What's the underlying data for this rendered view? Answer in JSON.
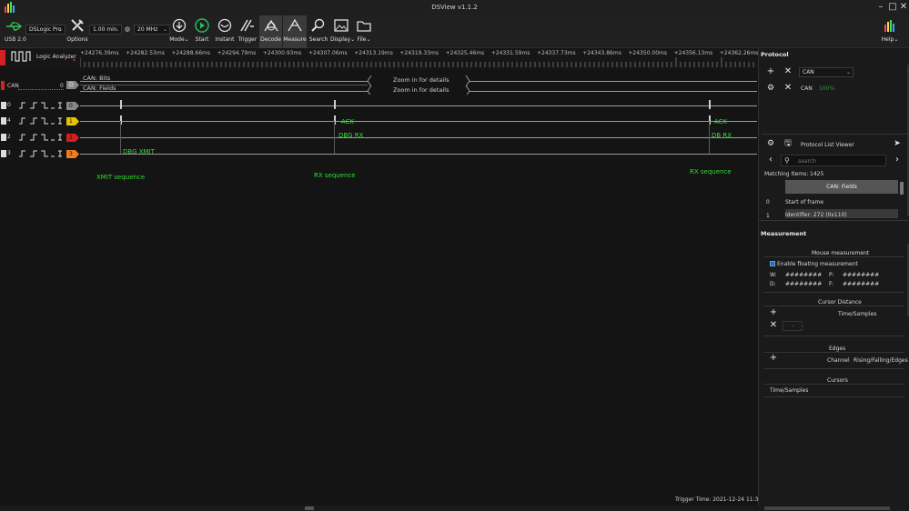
{
  "window": {
    "title": "DSView v1.1.2"
  },
  "toolbar": {
    "device_name": "DSLogic Pro",
    "usb_label": "USB 2.0",
    "options_label": "Options",
    "duration": "1.00 min",
    "samplerate": "20 MHz",
    "buttons": {
      "mode": "Mode",
      "start": "Start",
      "instant": "Instant",
      "trigger": "Trigger",
      "decode": "Decode",
      "measure": "Measure",
      "search": "Search",
      "display": "Display",
      "file": "File",
      "help": "Help"
    }
  },
  "ruler": {
    "mode_label": "Logic Analyzer",
    "ticks": [
      "+24276.39ms",
      "+24282.53ms",
      "+24288.66ms",
      "+24294.79ms",
      "+24300.93ms",
      "+24307.06ms",
      "+24313.19ms",
      "+24319.33ms",
      "+24325.46ms",
      "+24331.59ms",
      "+24337.73ms",
      "+24343.86ms",
      "+24350.00ms",
      "+24356.13ms",
      "+24362.26ms"
    ]
  },
  "channels": {
    "can": {
      "name": "CAN",
      "index": "0",
      "badge": "D",
      "rows": [
        "CAN: Bits",
        "CAN: Fields"
      ],
      "zoom_msg": "Zoom in for details"
    },
    "ch0": {
      "index": "0",
      "badge": "0"
    },
    "ch4": {
      "index": "4",
      "badge": "1",
      "ann1": "ACK",
      "ann2": "ACK"
    },
    "ch2": {
      "index": "2",
      "badge": "2",
      "ann1": "DBG RX",
      "ann2": "DB RX"
    },
    "ch3": {
      "index": "3",
      "badge": "3",
      "ann1": "DBG XMIT"
    },
    "notes": {
      "xmit": "XMIT sequence",
      "rx1": "RX  sequence",
      "rx2": "RX sequence"
    }
  },
  "status": {
    "trigger_time": "Trigger Time: 2021-12-24 11:34:32"
  },
  "protocol": {
    "header": "Protocol",
    "selector_value": "CAN",
    "decoder_name": "CAN",
    "decoder_progress": "100%",
    "list_viewer_title": "Protocol List Viewer",
    "search_placeholder": "search",
    "matching_label": "Matching Items:",
    "matching_count": "1425",
    "column_header": "CAN: Fields",
    "rows": [
      {
        "idx": "0",
        "text": "Start of frame"
      },
      {
        "idx": "1",
        "text": "Identifier: 272 (0x110)"
      }
    ]
  },
  "measurement": {
    "header": "Measurement",
    "mouse_header": "Mouse measurement",
    "enable_floating": "Enable floating measurement",
    "w_label": "W:",
    "w_value": "########",
    "p_label": "P:",
    "p_value": "########",
    "d_label": "D:",
    "d_value": "########",
    "f_label": "F:",
    "f_value": "########",
    "cursor_distance_header": "Cursor Distance",
    "time_samples": "Time/Samples",
    "edges_header": "Edges",
    "channel_label": "Channel",
    "rising_label": "Rising/Falling/Edges",
    "cursors_header": "Cursors",
    "cursors_time_samples": "Time/Samples",
    "dash": "-"
  },
  "colors": {
    "accent_green": "#33dd33",
    "ch4": "#e8c400",
    "ch2": "#d42020",
    "ch3": "#f07d1e",
    "can_marker": "#d42020"
  }
}
